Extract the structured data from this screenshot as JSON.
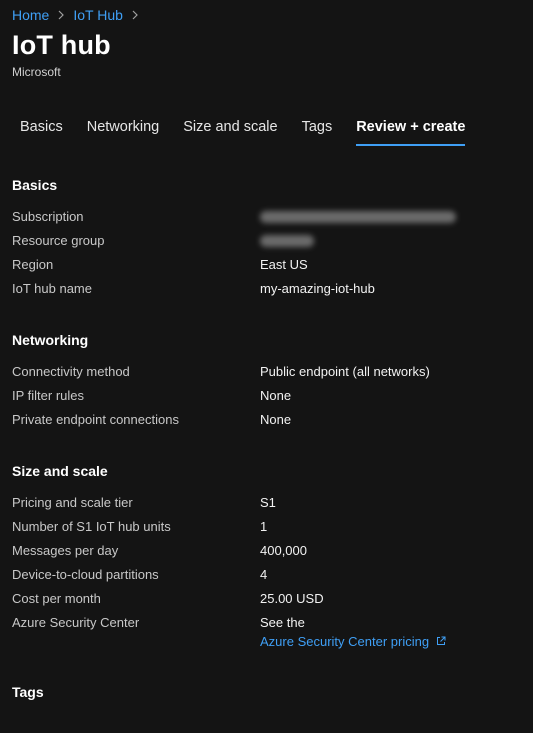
{
  "breadcrumb": {
    "items": [
      "Home",
      "IoT Hub"
    ]
  },
  "header": {
    "title": "IoT hub",
    "publisher": "Microsoft"
  },
  "tabs": [
    {
      "label": "Basics"
    },
    {
      "label": "Networking"
    },
    {
      "label": "Size and scale"
    },
    {
      "label": "Tags"
    },
    {
      "label": "Review + create",
      "active": true
    }
  ],
  "basics": {
    "title": "Basics",
    "subscription_label": "Subscription",
    "subscription_value_redacted": true,
    "resource_group_label": "Resource group",
    "resource_group_value_redacted": true,
    "region_label": "Region",
    "region_value": "East US",
    "hub_name_label": "IoT hub name",
    "hub_name_value": "my-amazing-iot-hub"
  },
  "networking": {
    "title": "Networking",
    "connectivity_label": "Connectivity method",
    "connectivity_value": "Public endpoint (all networks)",
    "ip_filter_label": "IP filter rules",
    "ip_filter_value": "None",
    "private_endpoint_label": "Private endpoint connections",
    "private_endpoint_value": "None"
  },
  "size_scale": {
    "title": "Size and scale",
    "tier_label": "Pricing and scale tier",
    "tier_value": "S1",
    "units_label": "Number of S1 IoT hub units",
    "units_value": "1",
    "messages_label": "Messages per day",
    "messages_value": "400,000",
    "partitions_label": "Device-to-cloud partitions",
    "partitions_value": "4",
    "cost_label": "Cost per month",
    "cost_value": "25.00 USD",
    "security_label": "Azure Security Center",
    "security_value": "See the",
    "security_link": "Azure Security Center pricing"
  },
  "tags": {
    "title": "Tags"
  },
  "colors": {
    "background": "#141414",
    "link": "#3f9ff5",
    "text": "#f2f2f2"
  },
  "icons": {
    "breadcrumb_separator": "chevron-right-icon",
    "external_link": "external-link-icon"
  }
}
